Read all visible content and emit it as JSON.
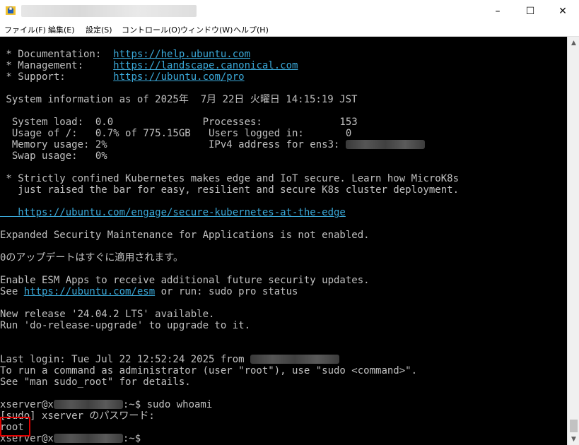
{
  "window": {
    "minimize_icon": "–",
    "maximize_icon": "☐",
    "close_icon": "✕"
  },
  "menu": [
    "ファイル(F)",
    "編集(E)",
    "設定(S)",
    "コントロール(O)",
    "ウィンドウ(W)",
    "ヘルプ(H)"
  ],
  "terminal": {
    "doc_label": " * Documentation:  ",
    "doc_url": "https://help.ubuntu.com",
    "mgmt_label": " * Management:     ",
    "mgmt_url": "https://landscape.canonical.com",
    "support_label": " * Support:        ",
    "support_url": "https://ubuntu.com/pro",
    "sysinfo": " System information as of 2025年  7月 22日 火曜日 14:15:19 JST",
    "sysload": "  System load:  0.0               Processes:             153",
    "usage": "  Usage of /:   0.7% of 775.15GB   Users logged in:       0",
    "memory": "  Memory usage: 2%                 IPv4 address for ens3: ",
    "swap": "  Swap usage:   0%",
    "k8s1": " * Strictly confined Kubernetes makes edge and IoT secure. Learn how MicroK8s",
    "k8s2": "   just raised the bar for easy, resilient and secure K8s cluster deployment.",
    "k8s_url": "   https://ubuntu.com/engage/secure-kubernetes-at-the-edge",
    "esm": "Expanded Security Maintenance for Applications is not enabled.",
    "updates": "0のアップデートはすぐに適用されます。",
    "esm_apps": "Enable ESM Apps to receive additional future security updates.",
    "see_prefix": "See ",
    "esm_url": "https://ubuntu.com/esm",
    "see_suffix": " or run: sudo pro status",
    "release1": "New release '24.04.2 LTS' available.",
    "release2": "Run 'do-release-upgrade' to upgrade to it.",
    "lastlogin": "Last login: Tue Jul 22 12:52:24 2025 from ",
    "admin1": "To run a command as administrator (user \"root\"), use \"sudo <command>\".",
    "admin2": "See \"man sudo_root\" for details.",
    "prompt_user": "xserver@x",
    "cmd1": ":~$ sudo whoami",
    "sudo_prompt": "[sudo] xserver のパスワード:",
    "output": "root",
    "cmd2": ":~$"
  }
}
